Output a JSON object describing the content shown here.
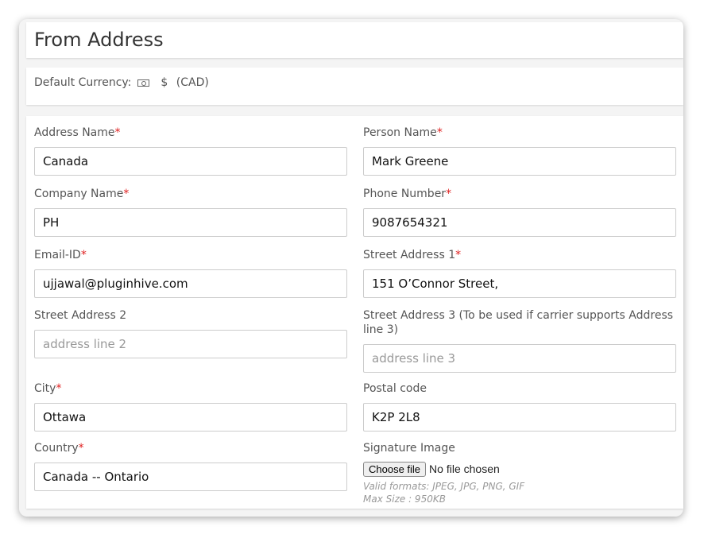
{
  "title": "From Address",
  "currency": {
    "label": "Default Currency:",
    "icon": "money-icon",
    "symbol": "$",
    "code": "(CAD)"
  },
  "fields": {
    "address_name": {
      "label": "Address Name",
      "value": "Canada"
    },
    "person_name": {
      "label": "Person Name",
      "value": "Mark Greene"
    },
    "company_name": {
      "label": "Company Name",
      "value": "PH"
    },
    "phone_number": {
      "label": "Phone Number",
      "value": "9087654321"
    },
    "email": {
      "label": "Email-ID",
      "value": "ujjawal@pluginhive.com"
    },
    "street1": {
      "label": "Street Address 1",
      "value": "151 O’Connor Street,"
    },
    "street2": {
      "label": "Street Address 2",
      "value": "",
      "placeholder": "address line 2"
    },
    "street3": {
      "label": "Street Address 3 (To be used if carrier supports Address line 3)",
      "value": "",
      "placeholder": "address line 3"
    },
    "city": {
      "label": "City",
      "value": "Ottawa"
    },
    "postal": {
      "label": "Postal code",
      "value": "K2P 2L8"
    },
    "country": {
      "label": "Country",
      "value": "Canada -- Ontario"
    },
    "signature": {
      "label": "Signature Image",
      "button": "Choose file",
      "status": "No file chosen",
      "formats": "Valid formats: JPEG, JPG, PNG, GIF",
      "max_size": "Max Size : 950KB"
    }
  },
  "required_marker": "*"
}
